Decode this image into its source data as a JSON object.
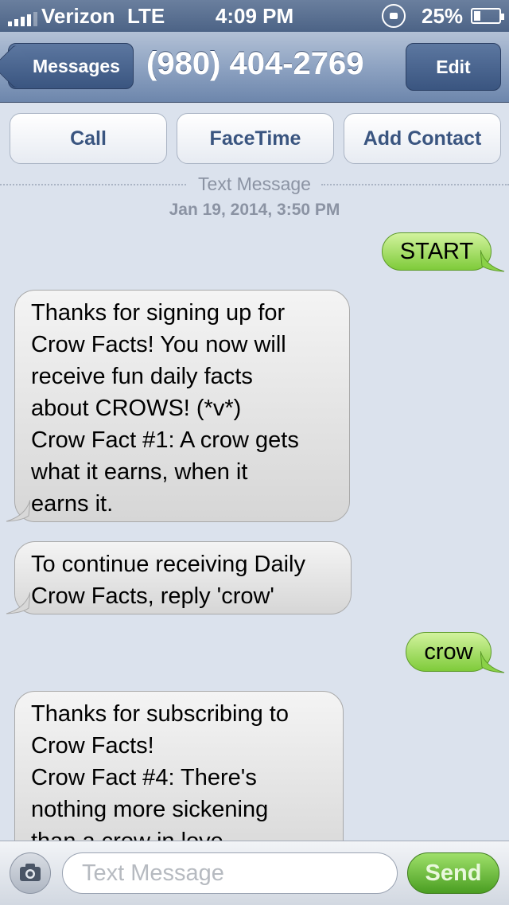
{
  "status_bar": {
    "carrier": "Verizon",
    "network": "LTE",
    "time": "4:09 PM",
    "battery": "25%"
  },
  "nav": {
    "back_label": "Messages",
    "title": "(980) 404-2769",
    "edit_label": "Edit"
  },
  "actions": {
    "call": "Call",
    "facetime": "FaceTime",
    "add_contact": "Add Contact"
  },
  "thread": {
    "label": "Text Message",
    "date": "Jan 19, 2014, 3:50 PM"
  },
  "messages": [
    {
      "from": "me",
      "lines": [
        "START"
      ]
    },
    {
      "from": "them",
      "lines": [
        "Thanks for signing up for",
        "Crow Facts! You now will",
        "receive fun daily facts",
        "about CROWS! (*v*)",
        "Crow Fact #1: A crow gets",
        "what it earns, when it",
        "earns it."
      ]
    },
    {
      "from": "them",
      "lines": [
        "To continue receiving Daily",
        "Crow Facts, reply 'crow'"
      ]
    },
    {
      "from": "me",
      "lines": [
        "crow"
      ]
    },
    {
      "from": "them",
      "lines": [
        "Thanks for subscribing to",
        "Crow Facts!",
        "Crow Fact #4: There's",
        "nothing more sickening",
        "than a crow in love"
      ]
    }
  ],
  "composer": {
    "placeholder": "Text Message",
    "send_label": "Send"
  },
  "colors": {
    "nav_blue": "#6d86ac",
    "outgoing_green": "#7fcb3a",
    "incoming_gray": "#d6d6d6",
    "background": "#dbe2ed"
  }
}
